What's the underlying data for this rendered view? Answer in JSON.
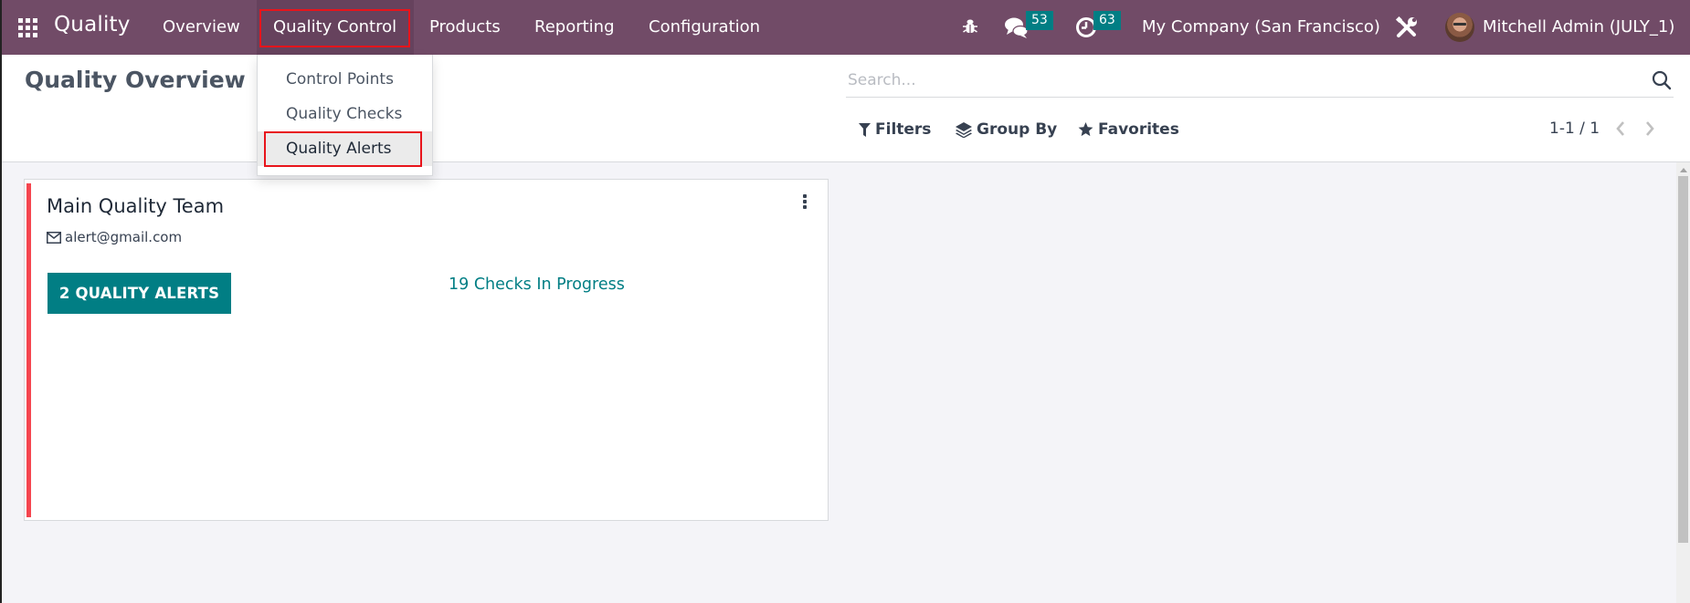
{
  "navbar": {
    "app_name": "Quality",
    "menu": [
      {
        "label": "Overview"
      },
      {
        "label": "Quality Control",
        "active": true
      },
      {
        "label": "Products"
      },
      {
        "label": "Reporting"
      },
      {
        "label": "Configuration"
      }
    ],
    "icons": {
      "apps": "apps-grid-icon",
      "debug": "bug-icon",
      "messages": "chat-icon",
      "activities": "clock-icon",
      "settings": "tools-icon"
    },
    "messages_count": "53",
    "activities_count": "63",
    "company": "My Company (San Francisco)",
    "user": "Mitchell Admin (JULY_1)"
  },
  "dropdown": {
    "items": [
      {
        "label": "Control Points"
      },
      {
        "label": "Quality Checks"
      },
      {
        "label": "Quality Alerts",
        "highlighted": true
      }
    ]
  },
  "control_panel": {
    "title": "Quality Overview",
    "search_placeholder": "Search...",
    "filters_label": "Filters",
    "groupby_label": "Group By",
    "favorites_label": "Favorites",
    "pager": "1-1 / 1"
  },
  "kanban": {
    "cards": [
      {
        "title": "Main Quality Team",
        "email": "alert@gmail.com",
        "alerts_button": "2 QUALITY ALERTS",
        "checks_link": "19 Checks In Progress",
        "stripe_color": "#f5454f"
      }
    ]
  },
  "colors": {
    "brand": "#714b67",
    "accent": "#017e84",
    "highlight_box": "#e8141b"
  }
}
